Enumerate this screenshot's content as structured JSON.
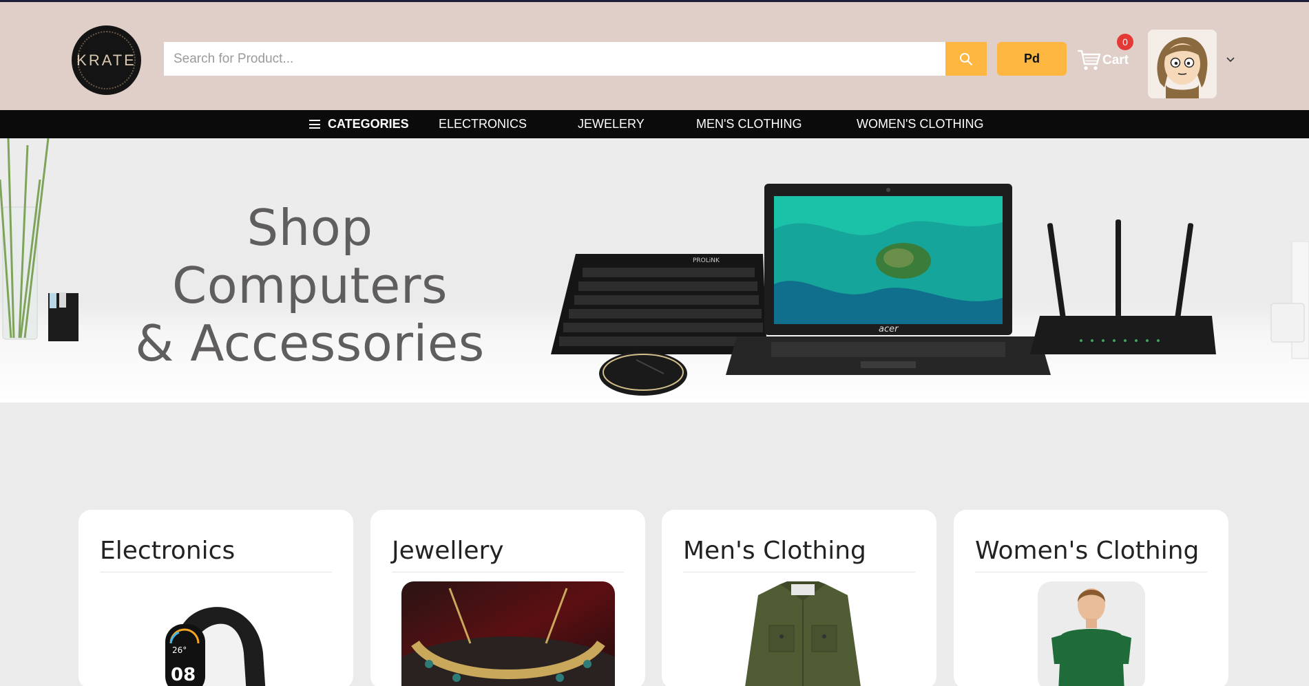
{
  "header": {
    "logo_text": "KRATE",
    "search_placeholder": "Search for Product...",
    "pd_label": "Pd",
    "cart_label": "Cart",
    "cart_count": "0"
  },
  "nav": {
    "categories_label": "CATEGORIES",
    "items": [
      "ELECTRONICS",
      "JEWELERY",
      "MEN'S CLOTHING",
      "WOMEN'S CLOTHING"
    ]
  },
  "banner": {
    "line1": "Shop Computers",
    "line2": "& Accessories",
    "laptop_brand": "acer",
    "keyboard_brand": "PROLiNK"
  },
  "cards": [
    {
      "title": "Electronics",
      "watch_time": "08",
      "watch_temp": "26°"
    },
    {
      "title": "Jewellery"
    },
    {
      "title": "Men's Clothing"
    },
    {
      "title": "Women's Clothing"
    }
  ],
  "colors": {
    "header_bg": "#dfcfc8",
    "accent": "#fdb740",
    "nav_bg": "#0b0b0b",
    "badge": "#e53935"
  },
  "icons": [
    "search-icon",
    "cart-icon",
    "menu-icon",
    "chevron-down-icon"
  ]
}
